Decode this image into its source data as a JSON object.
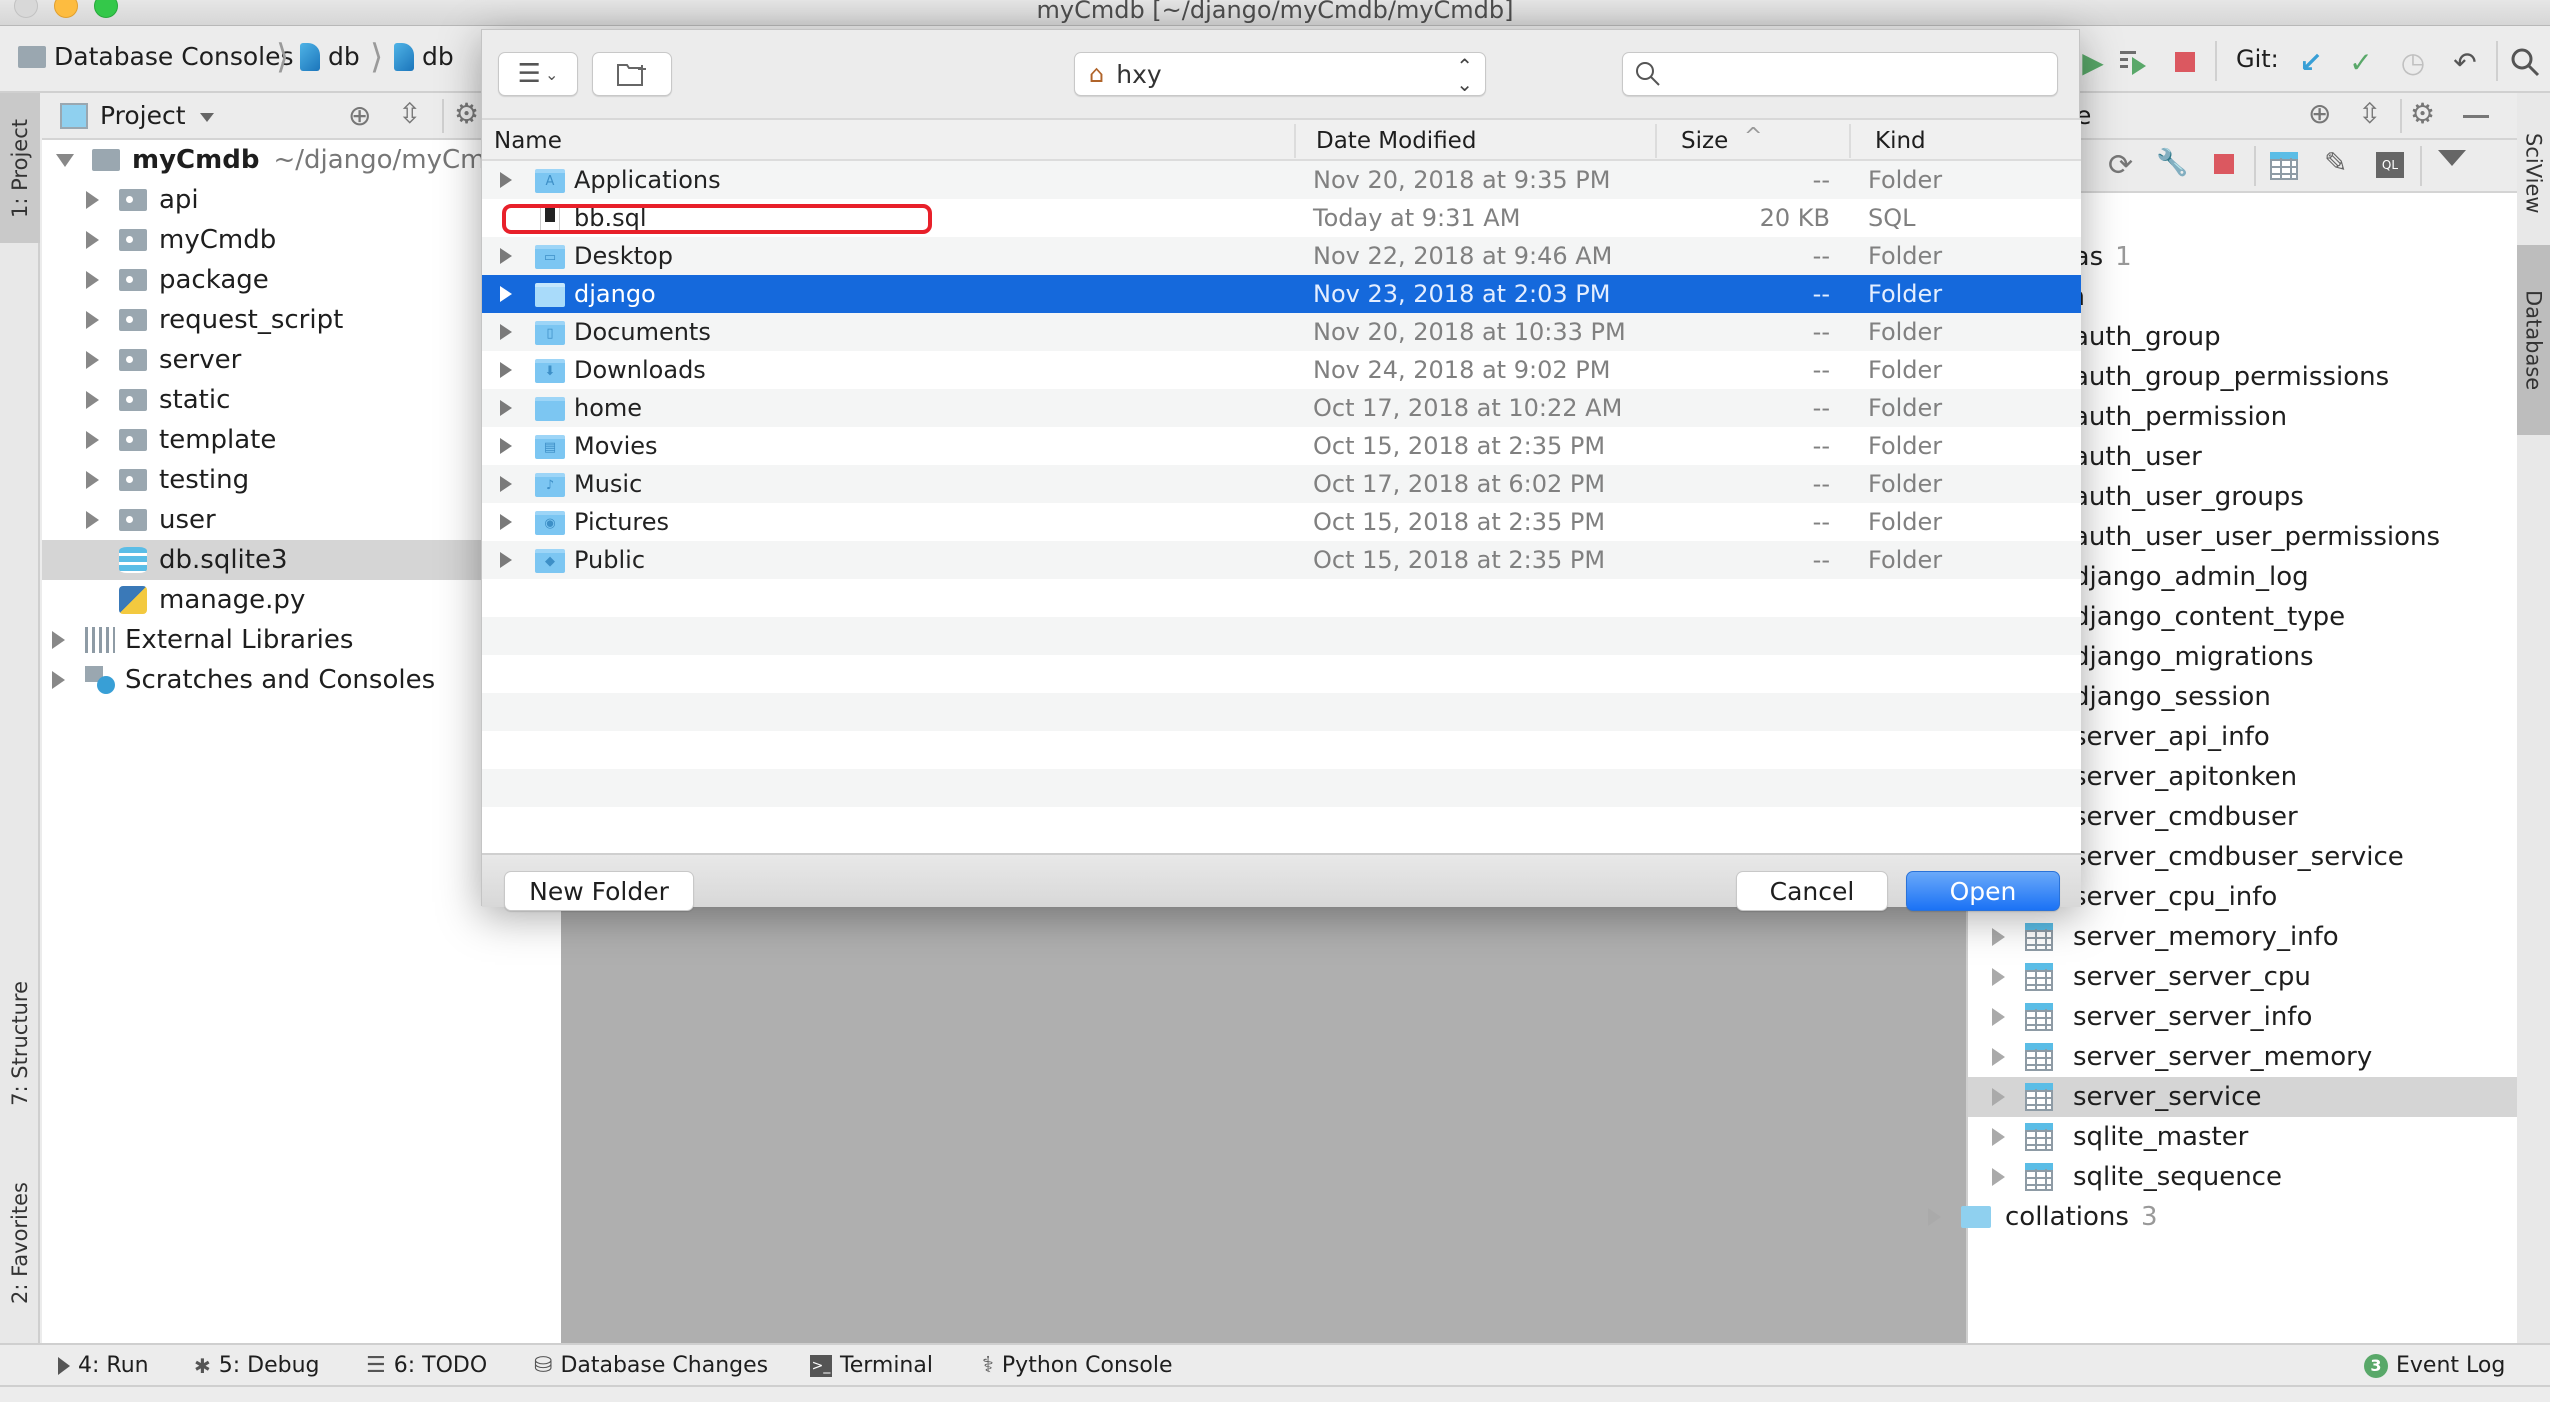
{
  "window": {
    "title": "myCmdb [~/django/myCmdb/myCmdb]",
    "traffic_colors": [
      "#d8d8d8",
      "#fdbc40",
      "#34c84a"
    ]
  },
  "breadcrumb": {
    "items": [
      "Database Consoles",
      "db",
      "db"
    ]
  },
  "toolbar": {
    "git_label": "Git:",
    "icons": [
      "run-icon",
      "run-file-icon",
      "stop-icon",
      "git-update-icon",
      "git-commit-icon",
      "git-history-icon",
      "git-revert-icon",
      "search-icon"
    ]
  },
  "left_stripe": {
    "tabs": [
      {
        "label": "1: Project",
        "icon": "folder-icon"
      },
      {
        "label": "7: Structure",
        "icon": "structure-icon"
      },
      {
        "label": "2: Favorites",
        "icon": "star-icon"
      }
    ]
  },
  "project_panel": {
    "title": "Project",
    "root": {
      "name": "myCmdb",
      "path": "~/django/myCmdb/"
    },
    "children": [
      {
        "name": "api",
        "type": "package"
      },
      {
        "name": "myCmdb",
        "type": "package"
      },
      {
        "name": "package",
        "type": "package"
      },
      {
        "name": "request_script",
        "type": "package"
      },
      {
        "name": "server",
        "type": "package"
      },
      {
        "name": "static",
        "type": "package"
      },
      {
        "name": "template",
        "type": "package"
      },
      {
        "name": "testing",
        "type": "package"
      },
      {
        "name": "user",
        "type": "package"
      },
      {
        "name": "db.sqlite3",
        "type": "database",
        "selected": true
      },
      {
        "name": "manage.py",
        "type": "python"
      }
    ],
    "extras": [
      {
        "name": "External Libraries",
        "icon": "library-icon"
      },
      {
        "name": "Scratches and Consoles",
        "icon": "scratches-icon"
      }
    ]
  },
  "dialog": {
    "location": "hxy",
    "search_placeholder": "",
    "columns": {
      "name": "Name",
      "date": "Date Modified",
      "size": "Size",
      "kind": "Kind"
    },
    "files": [
      {
        "name": "Applications",
        "date": "Nov 20, 2018 at 9:35 PM",
        "size": "--",
        "kind": "Folder",
        "glyph": "A",
        "folder": true
      },
      {
        "name": "bb.sql",
        "date": "Today at 9:31 AM",
        "size": "20 KB",
        "kind": "SQL",
        "folder": false,
        "highlighted": true
      },
      {
        "name": "Desktop",
        "date": "Nov 22, 2018 at 9:46 AM",
        "size": "--",
        "kind": "Folder",
        "glyph": "▭",
        "folder": true
      },
      {
        "name": "django",
        "date": "Nov 23, 2018 at 2:03 PM",
        "size": "--",
        "kind": "Folder",
        "glyph": "",
        "folder": true,
        "selected": true
      },
      {
        "name": "Documents",
        "date": "Nov 20, 2018 at 10:33 PM",
        "size": "--",
        "kind": "Folder",
        "glyph": "▯",
        "folder": true
      },
      {
        "name": "Downloads",
        "date": "Nov 24, 2018 at 9:02 PM",
        "size": "--",
        "kind": "Folder",
        "glyph": "⬇",
        "folder": true
      },
      {
        "name": "home",
        "date": "Oct 17, 2018 at 10:22 AM",
        "size": "--",
        "kind": "Folder",
        "glyph": "",
        "folder": true
      },
      {
        "name": "Movies",
        "date": "Oct 15, 2018 at 2:35 PM",
        "size": "--",
        "kind": "Folder",
        "glyph": "▤",
        "folder": true
      },
      {
        "name": "Music",
        "date": "Oct 17, 2018 at 6:02 PM",
        "size": "--",
        "kind": "Folder",
        "glyph": "♪",
        "folder": true
      },
      {
        "name": "Pictures",
        "date": "Oct 15, 2018 at 2:35 PM",
        "size": "--",
        "kind": "Folder",
        "glyph": "◉",
        "folder": true
      },
      {
        "name": "Public",
        "date": "Oct 15, 2018 at 2:35 PM",
        "size": "--",
        "kind": "Folder",
        "glyph": "◆",
        "folder": true
      }
    ],
    "buttons": {
      "new_folder": "New Folder",
      "cancel": "Cancel",
      "open": "Open"
    },
    "accent": "#1569dc"
  },
  "database_panel": {
    "title_fragment": "e",
    "datasource_count": "1",
    "schemas": {
      "label": "schemas",
      "count": "1"
    },
    "schema_name": "main",
    "tables": [
      "auth_group",
      "auth_group_permissions",
      "auth_permission",
      "auth_user",
      "auth_user_groups",
      "auth_user_user_permissions",
      "django_admin_log",
      "django_content_type",
      "django_migrations",
      "django_session",
      "server_api_info",
      "server_apitonken",
      "server_cmdbuser",
      "server_cmdbuser_service",
      "server_cpu_info",
      "server_memory_info",
      "server_server_cpu",
      "server_server_info",
      "server_server_memory",
      "server_service",
      "sqlite_master",
      "sqlite_sequence"
    ],
    "selected_table": "server_service",
    "collations": {
      "label": "collations",
      "count": "3"
    }
  },
  "right_stripe": {
    "tabs": [
      "SciView",
      "Database"
    ]
  },
  "bottom_bar": {
    "tabs": [
      {
        "label": "4: Run",
        "icon": "run-icon"
      },
      {
        "label": "5: Debug",
        "icon": "bug-icon"
      },
      {
        "label": "6: TODO",
        "icon": "todo-icon"
      },
      {
        "label": "Database Changes",
        "icon": "database-changes-icon"
      },
      {
        "label": "Terminal",
        "icon": "terminal-icon"
      },
      {
        "label": "Python Console",
        "icon": "python-icon"
      }
    ],
    "event_log": {
      "label": "Event Log",
      "count": "3"
    }
  }
}
